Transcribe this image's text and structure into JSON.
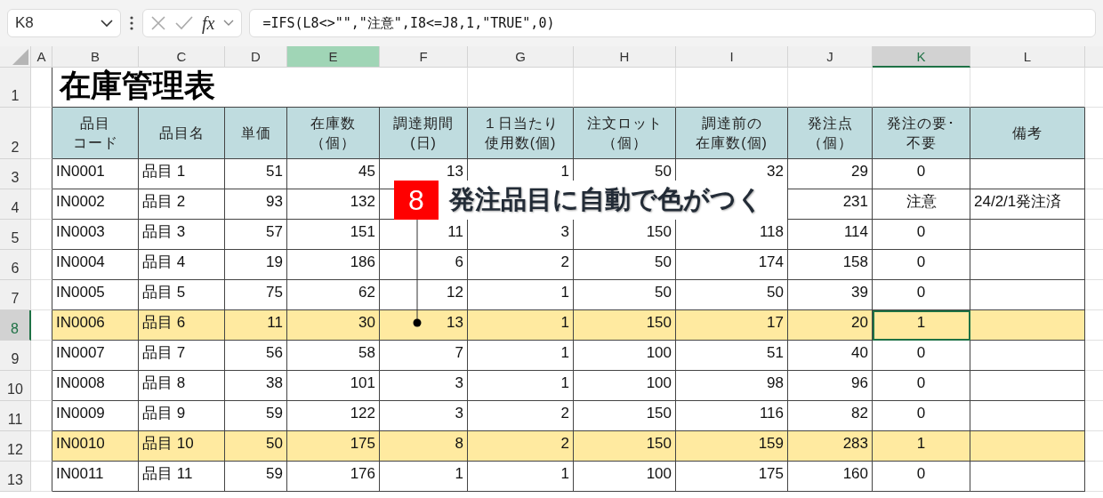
{
  "formula_bar": {
    "name_box": "K8",
    "function_label": "fx",
    "formula": "=IFS(L8<>\"\",\"注意\",I8<=J8,1,\"TRUE\",0)"
  },
  "columns": [
    {
      "label": "A",
      "selected": false,
      "highlighted": false
    },
    {
      "label": "B",
      "selected": false,
      "highlighted": false
    },
    {
      "label": "C",
      "selected": false,
      "highlighted": false
    },
    {
      "label": "D",
      "selected": false,
      "highlighted": false
    },
    {
      "label": "E",
      "selected": false,
      "highlighted": true
    },
    {
      "label": "F",
      "selected": false,
      "highlighted": false
    },
    {
      "label": "G",
      "selected": false,
      "highlighted": false
    },
    {
      "label": "H",
      "selected": false,
      "highlighted": false
    },
    {
      "label": "I",
      "selected": false,
      "highlighted": false
    },
    {
      "label": "J",
      "selected": false,
      "highlighted": false
    },
    {
      "label": "K",
      "selected": true,
      "highlighted": false
    },
    {
      "label": "L",
      "selected": false,
      "highlighted": false
    }
  ],
  "title_row": {
    "number": "1",
    "selected": false,
    "title": "在庫管理表"
  },
  "header_row": {
    "number": "2",
    "selected": false,
    "headers": [
      [
        "品目",
        "コード"
      ],
      [
        "品目名"
      ],
      [
        "単価"
      ],
      [
        "在庫数",
        "（個）"
      ],
      [
        "調達期間",
        "(日)"
      ],
      [
        "１日当たり",
        "使用数(個)"
      ],
      [
        "注文ロット",
        "（個）"
      ],
      [
        "調達前の",
        "在庫数(個)"
      ],
      [
        "発注点",
        "（個）"
      ],
      [
        "発注の要･",
        "不要"
      ],
      [
        "備考"
      ]
    ]
  },
  "rows": [
    {
      "number": "3",
      "selected": false,
      "highlighted": false,
      "active_col_selected": false,
      "cells": {
        "B": "IN0001",
        "C": "品目 1",
        "D": "51",
        "E": "45",
        "F": "13",
        "G": "1",
        "H": "50",
        "I": "32",
        "J": "29",
        "K": "0"
      }
    },
    {
      "number": "4",
      "selected": false,
      "highlighted": false,
      "active_col_selected": false,
      "cells": {
        "B": "IN0002",
        "C": "品目 2",
        "D": "93",
        "E": "132",
        "J": "231",
        "K": "注意",
        "L": "24/2/1発注済"
      }
    },
    {
      "number": "5",
      "selected": false,
      "highlighted": false,
      "active_col_selected": false,
      "cells": {
        "B": "IN0003",
        "C": "品目 3",
        "D": "57",
        "E": "151",
        "F": "11",
        "G": "3",
        "H": "150",
        "I": "118",
        "J": "114",
        "K": "0"
      }
    },
    {
      "number": "6",
      "selected": false,
      "highlighted": false,
      "active_col_selected": false,
      "cells": {
        "B": "IN0004",
        "C": "品目 4",
        "D": "19",
        "E": "186",
        "F": "6",
        "G": "2",
        "H": "50",
        "I": "174",
        "J": "158",
        "K": "0"
      }
    },
    {
      "number": "7",
      "selected": false,
      "highlighted": false,
      "active_col_selected": false,
      "cells": {
        "B": "IN0005",
        "C": "品目 5",
        "D": "75",
        "E": "62",
        "F": "12",
        "G": "1",
        "H": "50",
        "I": "50",
        "J": "39",
        "K": "0"
      }
    },
    {
      "number": "8",
      "selected": true,
      "highlighted": true,
      "active_col_selected": true,
      "cells": {
        "B": "IN0006",
        "C": "品目 6",
        "D": "11",
        "E": "30",
        "F": "13",
        "G": "1",
        "H": "150",
        "I": "17",
        "J": "20",
        "K": "1"
      }
    },
    {
      "number": "9",
      "selected": false,
      "highlighted": false,
      "active_col_selected": false,
      "cells": {
        "B": "IN0007",
        "C": "品目 7",
        "D": "56",
        "E": "58",
        "F": "7",
        "G": "1",
        "H": "100",
        "I": "51",
        "J": "40",
        "K": "0"
      }
    },
    {
      "number": "10",
      "selected": false,
      "highlighted": false,
      "active_col_selected": false,
      "cells": {
        "B": "IN0008",
        "C": "品目 8",
        "D": "38",
        "E": "101",
        "F": "3",
        "G": "1",
        "H": "100",
        "I": "98",
        "J": "96",
        "K": "0"
      }
    },
    {
      "number": "11",
      "selected": false,
      "highlighted": false,
      "active_col_selected": false,
      "cells": {
        "B": "IN0009",
        "C": "品目 9",
        "D": "59",
        "E": "122",
        "F": "3",
        "G": "2",
        "H": "150",
        "I": "116",
        "J": "82",
        "K": "0"
      }
    },
    {
      "number": "12",
      "selected": false,
      "highlighted": true,
      "active_col_selected": false,
      "cells": {
        "B": "IN0010",
        "C": "品目 10",
        "D": "50",
        "E": "175",
        "F": "8",
        "G": "2",
        "H": "150",
        "I": "159",
        "J": "283",
        "K": "1"
      }
    },
    {
      "number": "13",
      "selected": false,
      "highlighted": false,
      "active_col_selected": false,
      "cells": {
        "B": "IN0011",
        "C": "品目 11",
        "D": "59",
        "E": "176",
        "F": "1",
        "G": "1",
        "H": "100",
        "I": "175",
        "J": "160",
        "K": "0"
      }
    }
  ],
  "callout": {
    "badge": "8",
    "text": "発注品目に自動で色がつく"
  }
}
